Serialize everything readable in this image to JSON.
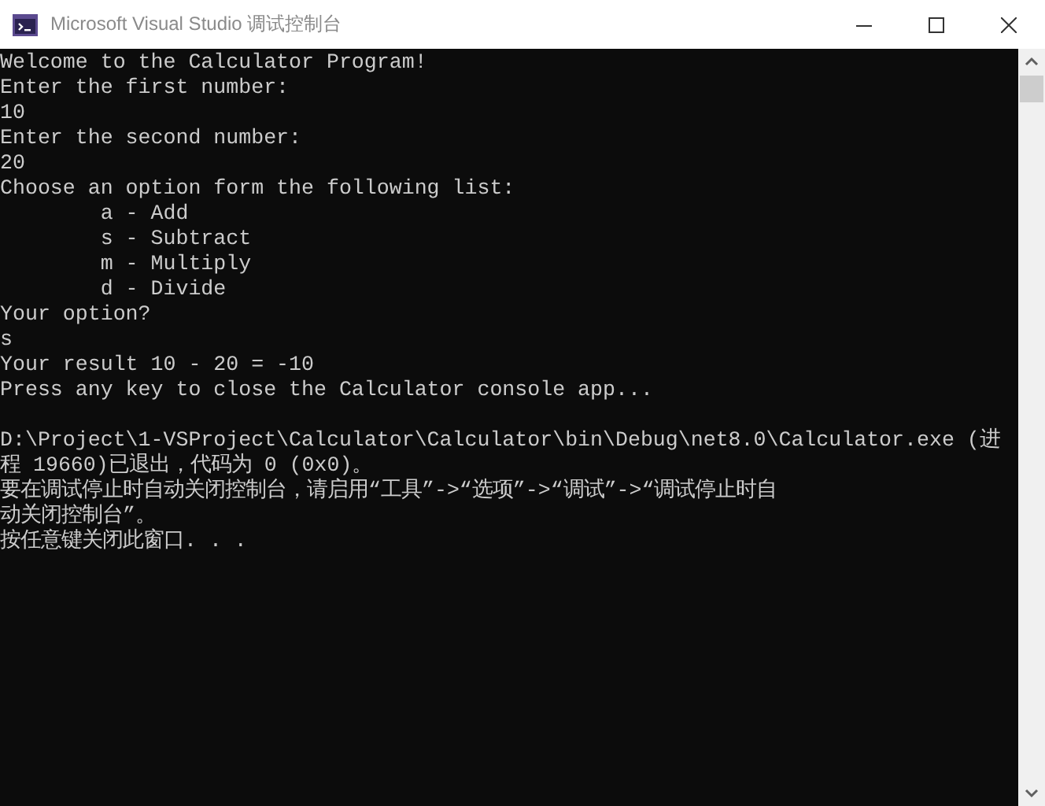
{
  "window": {
    "title": "Microsoft Visual Studio 调试控制台"
  },
  "console": {
    "blocks": [
      {
        "lines": [
          "Welcome to the Calculator Program!",
          "Enter the first number:",
          "10",
          "Enter the second number:",
          "20",
          "Choose an option form the following list:",
          "        a - Add",
          "        s - Subtract",
          "        m - Multiply",
          "        d - Divide",
          "Your option?",
          "s",
          "Your result 10 - 20 = -10",
          "Press any key to close the Calculator console app..."
        ]
      },
      {
        "lines": [
          "D:\\Project\\1-VSProject\\Calculator\\Calculator\\bin\\Debug\\net8.0\\Calculator.exe (进",
          "程 19660)已退出，代码为 0 (0x0)。",
          "要在调试停止时自动关闭控制台，请启用“工具”->“选项”->“调试”->“调试停止时自",
          "动关闭控制台”。",
          "按任意键关闭此窗口. . ."
        ]
      }
    ]
  }
}
